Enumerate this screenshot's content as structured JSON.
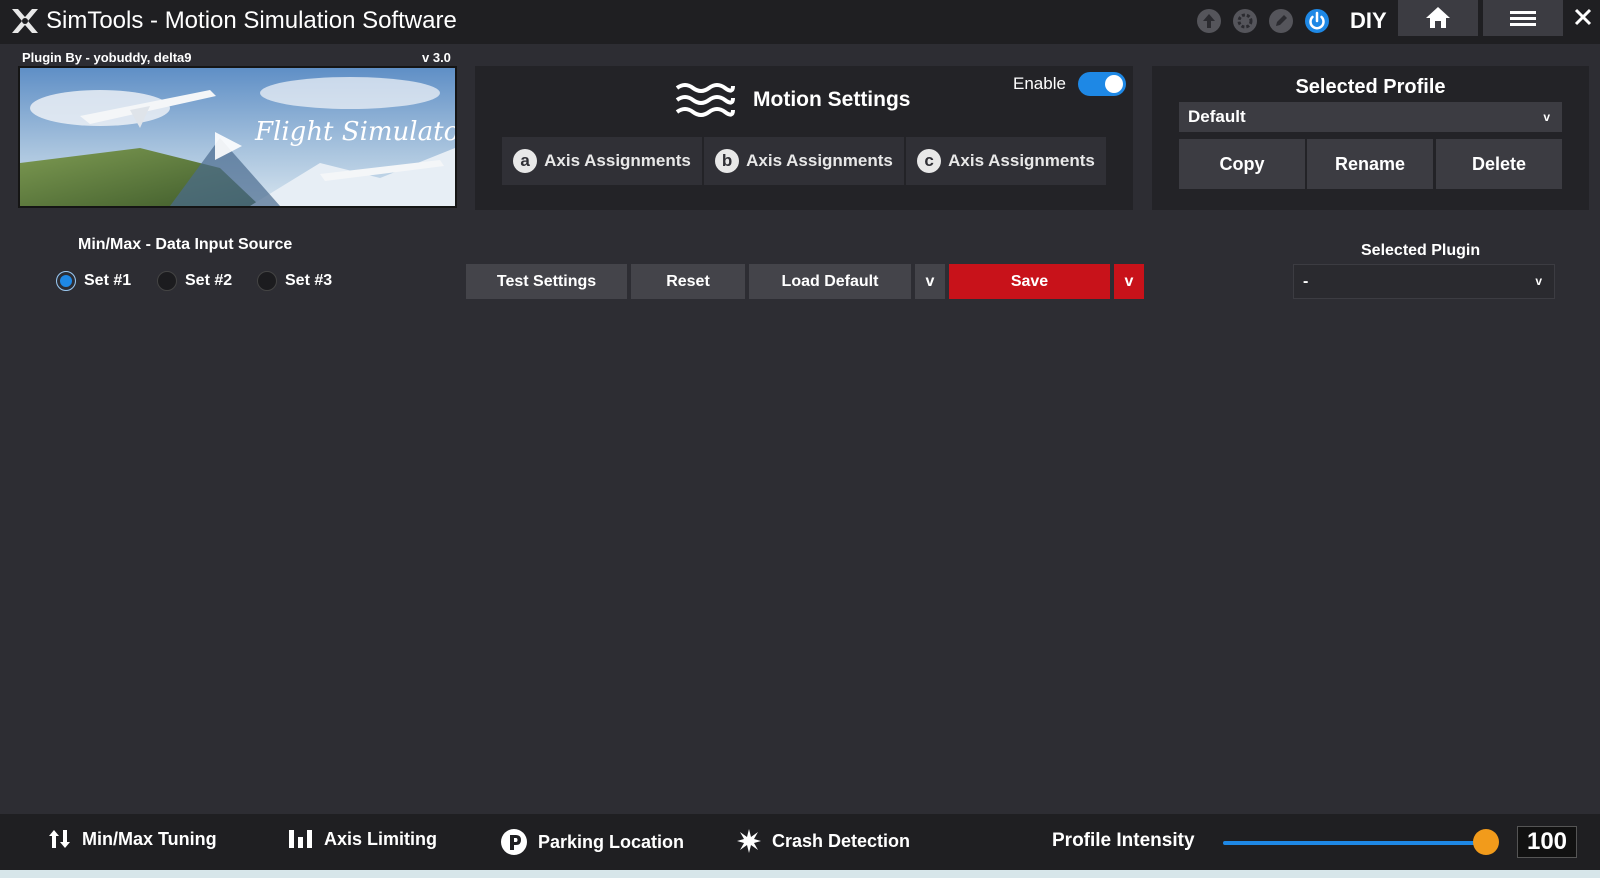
{
  "app": {
    "title": "SimTools - Motion Simulation Software",
    "diy_label": "DIY"
  },
  "plugin": {
    "by_label": "Plugin By - yobuddy, delta9",
    "version": "v 3.0",
    "banner_text": "Flight Simulator"
  },
  "motion": {
    "title": "Motion Settings",
    "enable_label": "Enable",
    "enabled": true,
    "tabs": [
      {
        "letter": "a",
        "label": "Axis Assignments"
      },
      {
        "letter": "b",
        "label": "Axis Assignments"
      },
      {
        "letter": "c",
        "label": "Axis Assignments"
      }
    ]
  },
  "profile": {
    "title": "Selected Profile",
    "selected": "Default",
    "buttons": {
      "copy": "Copy",
      "rename": "Rename",
      "delete": "Delete"
    }
  },
  "input_source": {
    "title": "Min/Max - Data Input Source",
    "options": [
      "Set #1",
      "Set #2",
      "Set #3"
    ],
    "selected": "Set #1"
  },
  "actions": {
    "test": "Test Settings",
    "reset": "Reset",
    "load_default": "Load Default",
    "dropdown": "v",
    "save": "Save"
  },
  "selected_plugin": {
    "title": "Selected Plugin",
    "value": "-"
  },
  "bottom": {
    "items": [
      "Min/Max Tuning",
      "Axis Limiting",
      "Parking Location",
      "Crash Detection"
    ],
    "intensity_label": "Profile Intensity",
    "intensity_value": "100",
    "intensity_fraction": 1.0
  },
  "colors": {
    "accent": "#1e88e5",
    "save": "#c8121a",
    "slider_knob": "#f29b1b"
  }
}
